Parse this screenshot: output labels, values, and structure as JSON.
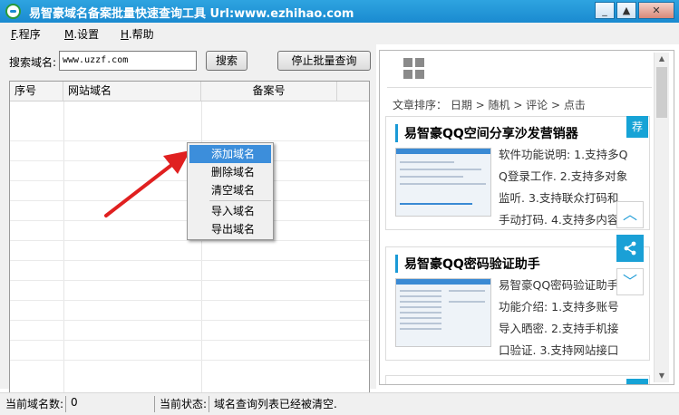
{
  "window": {
    "title": "易智豪域名备案批量快速查询工具 Url:www.ezhihao.com",
    "minimize": "_",
    "maximize": "▲",
    "close": "✕"
  },
  "menu": [
    {
      "hot": "F",
      "label": ".程序"
    },
    {
      "hot": "M",
      "label": ".设置"
    },
    {
      "hot": "H",
      "label": ".帮助"
    }
  ],
  "search": {
    "label": "搜索域名:",
    "value": "www.uzzf.com",
    "button": "搜索",
    "stop_button": "停止批量查询"
  },
  "table": {
    "columns": [
      "序号",
      "网站域名",
      "备案号"
    ]
  },
  "context_menu": {
    "items": [
      "添加域名",
      "删除域名",
      "清空域名",
      "导入域名",
      "导出域名"
    ],
    "highlighted": 0
  },
  "articles": {
    "sort_bar": "文章排序： 日期 > 随机 > 评论 > 点击",
    "badge": "荐",
    "cards": [
      {
        "title": "易智豪QQ空间分享沙发营销器",
        "lines": [
          "软件功能说明: 1.支持多Q",
          "Q登录工作. 2.支持多对象",
          "监听. 3.支持联众打码和",
          "手动打码. 4.支持多内容"
        ]
      },
      {
        "title": "易智豪QQ密码验证助手",
        "lines": [
          "易智豪QQ密码验证助手",
          "功能介绍: 1.支持多账号",
          "导入晒密. 2.支持手机接",
          "口验证. 3.支持网站接口"
        ]
      }
    ]
  },
  "status": {
    "count_label": "当前域名数:",
    "count_value": "0",
    "state_label": "当前状态:",
    "state_value": "域名查询列表已经被清空."
  },
  "colors": {
    "title_bar": "#1a8ad0",
    "accent": "#1a9ad6",
    "highlight": "#3c8edb",
    "arrow": "#e02020"
  }
}
